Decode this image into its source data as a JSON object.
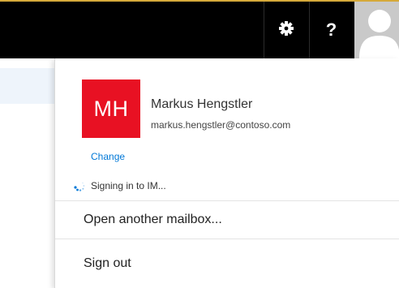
{
  "topbar": {
    "settings_icon": "gear-icon",
    "help_label": "?",
    "avatar_icon": "person-silhouette-icon"
  },
  "account": {
    "initials": "MH",
    "tile_color": "#e81123",
    "change_label": "Change",
    "name": "Markus Hengstler",
    "email": "markus.hengstler@contoso.com"
  },
  "status": {
    "icon": "loading-spinner-icon",
    "text": "Signing in to IM..."
  },
  "menu": {
    "open_mailbox": "Open another mailbox...",
    "sign_out": "Sign out"
  },
  "colors": {
    "topbar_bg": "#000000",
    "accent": "#d5a93a",
    "link": "#0078d7"
  }
}
